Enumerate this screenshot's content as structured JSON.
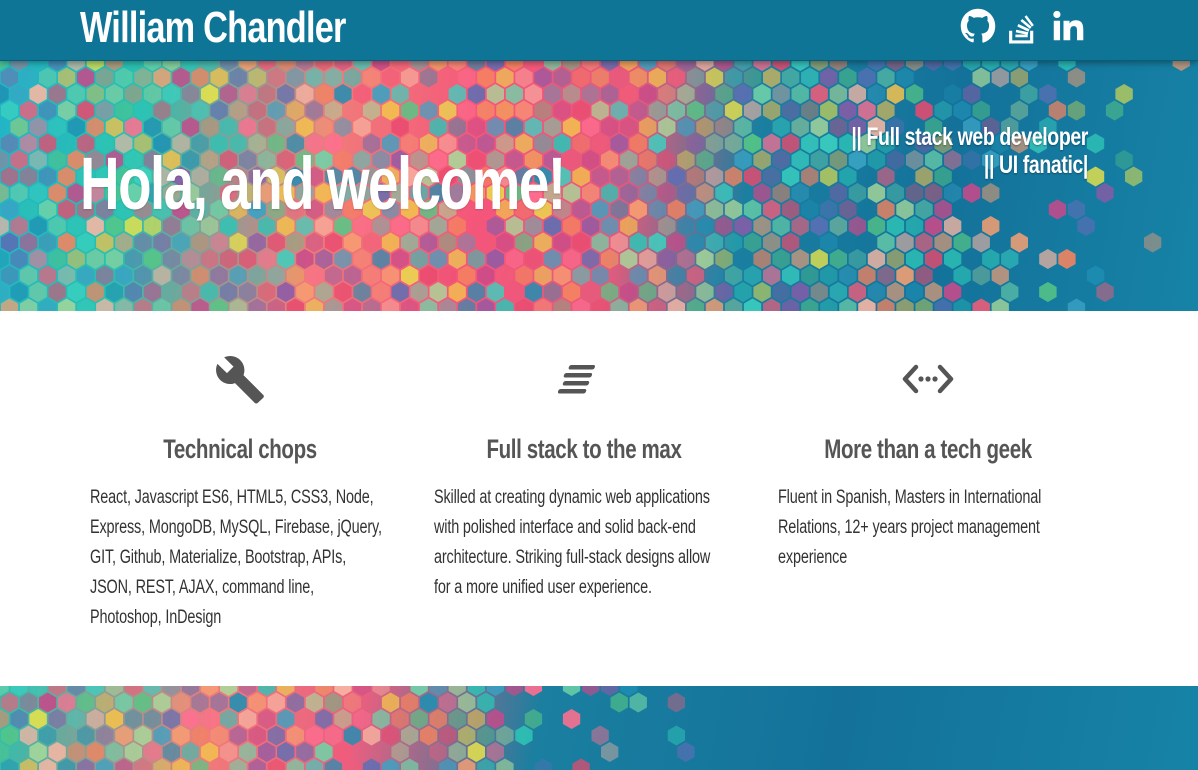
{
  "navbar": {
    "brand": "William Chandler",
    "social": [
      {
        "icon": "github-icon"
      },
      {
        "icon": "stackoverflow-icon"
      },
      {
        "icon": "linkedin-icon"
      }
    ]
  },
  "hero": {
    "title": "Hola, and welcome!",
    "tagline_line1": "|| Full stack web developer",
    "tagline_line2": "|| UI fanatic|"
  },
  "features": [
    {
      "icon": "wrench-icon",
      "title": "Technical chops",
      "text": "React, Javascript ES6, HTML5, CSS3, Node, Express, MongoDB, MySQL, Firebase, jQuery, GIT, Github, Materialize, Bootstrap, APIs, JSON, REST, AJAX, command line, Photoshop, InDesign"
    },
    {
      "icon": "align-lines-icon",
      "title": "Full stack to the max",
      "text": "Skilled at creating dynamic web applications with polished interface and solid back-end architecture. Striking full-stack designs allow for a more unified user experience."
    },
    {
      "icon": "code-brackets-icon",
      "title": "More than a tech geek",
      "text": "Fluent in Spanish, Masters in International Relations, 12+ years project management experience"
    }
  ],
  "colors": {
    "navbar": "#0e7596",
    "heading": "#555555",
    "body_text": "#333333",
    "icon": "#555555"
  }
}
